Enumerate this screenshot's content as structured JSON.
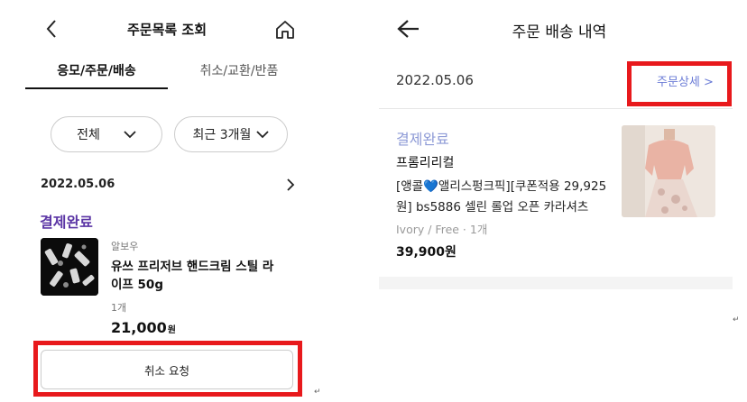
{
  "left": {
    "header": {
      "title": "주문목록 조회"
    },
    "tabs": [
      {
        "label": "응모/주문/배송",
        "active": true
      },
      {
        "label": "취소/교환/반품",
        "active": false
      }
    ],
    "filters": {
      "status": "전체",
      "period": "최근 3개월"
    },
    "order": {
      "date": "2022.05.06",
      "status": "결제완료",
      "brand": "알보우",
      "product_name": "유쓰 프리저브 핸드크림 스틸 라이프 50g",
      "quantity": "1개",
      "price": "21,000",
      "currency": "원",
      "cancel_label": "취소 요청"
    }
  },
  "right": {
    "header": {
      "title": "주문 배송 내역"
    },
    "order": {
      "date": "2022.05.06",
      "detail_link": "주문상세 >",
      "status": "결제완료",
      "seller": "프롬리리컬",
      "product_line1": "[앵콜💙앨리스펑크픽][쿠폰적용 29,925",
      "product_line2": "원] bs5886 셀린 롤업 오픈 카라셔츠",
      "option": "Ivory / Free · 1개",
      "price": "39,900원"
    }
  },
  "edit_marks": {
    "mark1": "↵",
    "mark2": "↵"
  },
  "colors": {
    "highlight_red": "#e8191c",
    "status_purple": "#5b35a5",
    "link_blue": "#6a7bd6",
    "status_light": "#8d9ad6"
  }
}
